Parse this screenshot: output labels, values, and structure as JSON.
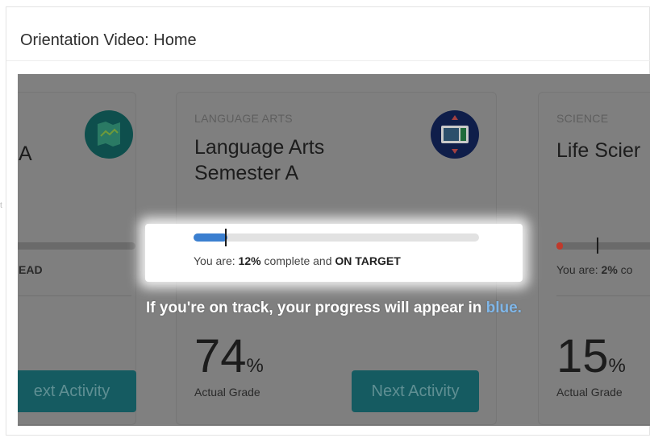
{
  "header": {
    "title": "Orientation Video: Home"
  },
  "left_card": {
    "title_fragment": "A",
    "status_fragment": "EAD",
    "button_label": "ext Activity",
    "icon": "map-icon"
  },
  "center_card": {
    "subject": "LANGUAGE ARTS",
    "title_line1": "Language Arts",
    "title_line2": "Semester A",
    "icon": "monitor-icon",
    "progress": {
      "value": 0.12,
      "target_marker": 0.11
    },
    "status": {
      "prefix": "You are: ",
      "percent": "12%",
      "middle": " complete and ",
      "state": "ON TARGET"
    },
    "grade": {
      "value": "74",
      "unit": "%",
      "label": "Actual Grade"
    },
    "button_label": "Next Activity"
  },
  "right_card": {
    "subject": "SCIENCE",
    "title": "Life Scier",
    "status_prefix": "You are: ",
    "status_percent": "2%",
    "status_suffix": " co",
    "grade": {
      "value": "15",
      "unit": "%",
      "label": "Actual Grade"
    },
    "icon": "flask-icon"
  },
  "overlay": {
    "caption_main": "If you're on track, your progress will appear in ",
    "caption_highlight": "blue."
  },
  "colors": {
    "progress_blue": "#3b7fd0",
    "button_teal": "#155b61",
    "caption_blue": "#7fb6e8",
    "behind_dot_red": "#c0392b"
  }
}
